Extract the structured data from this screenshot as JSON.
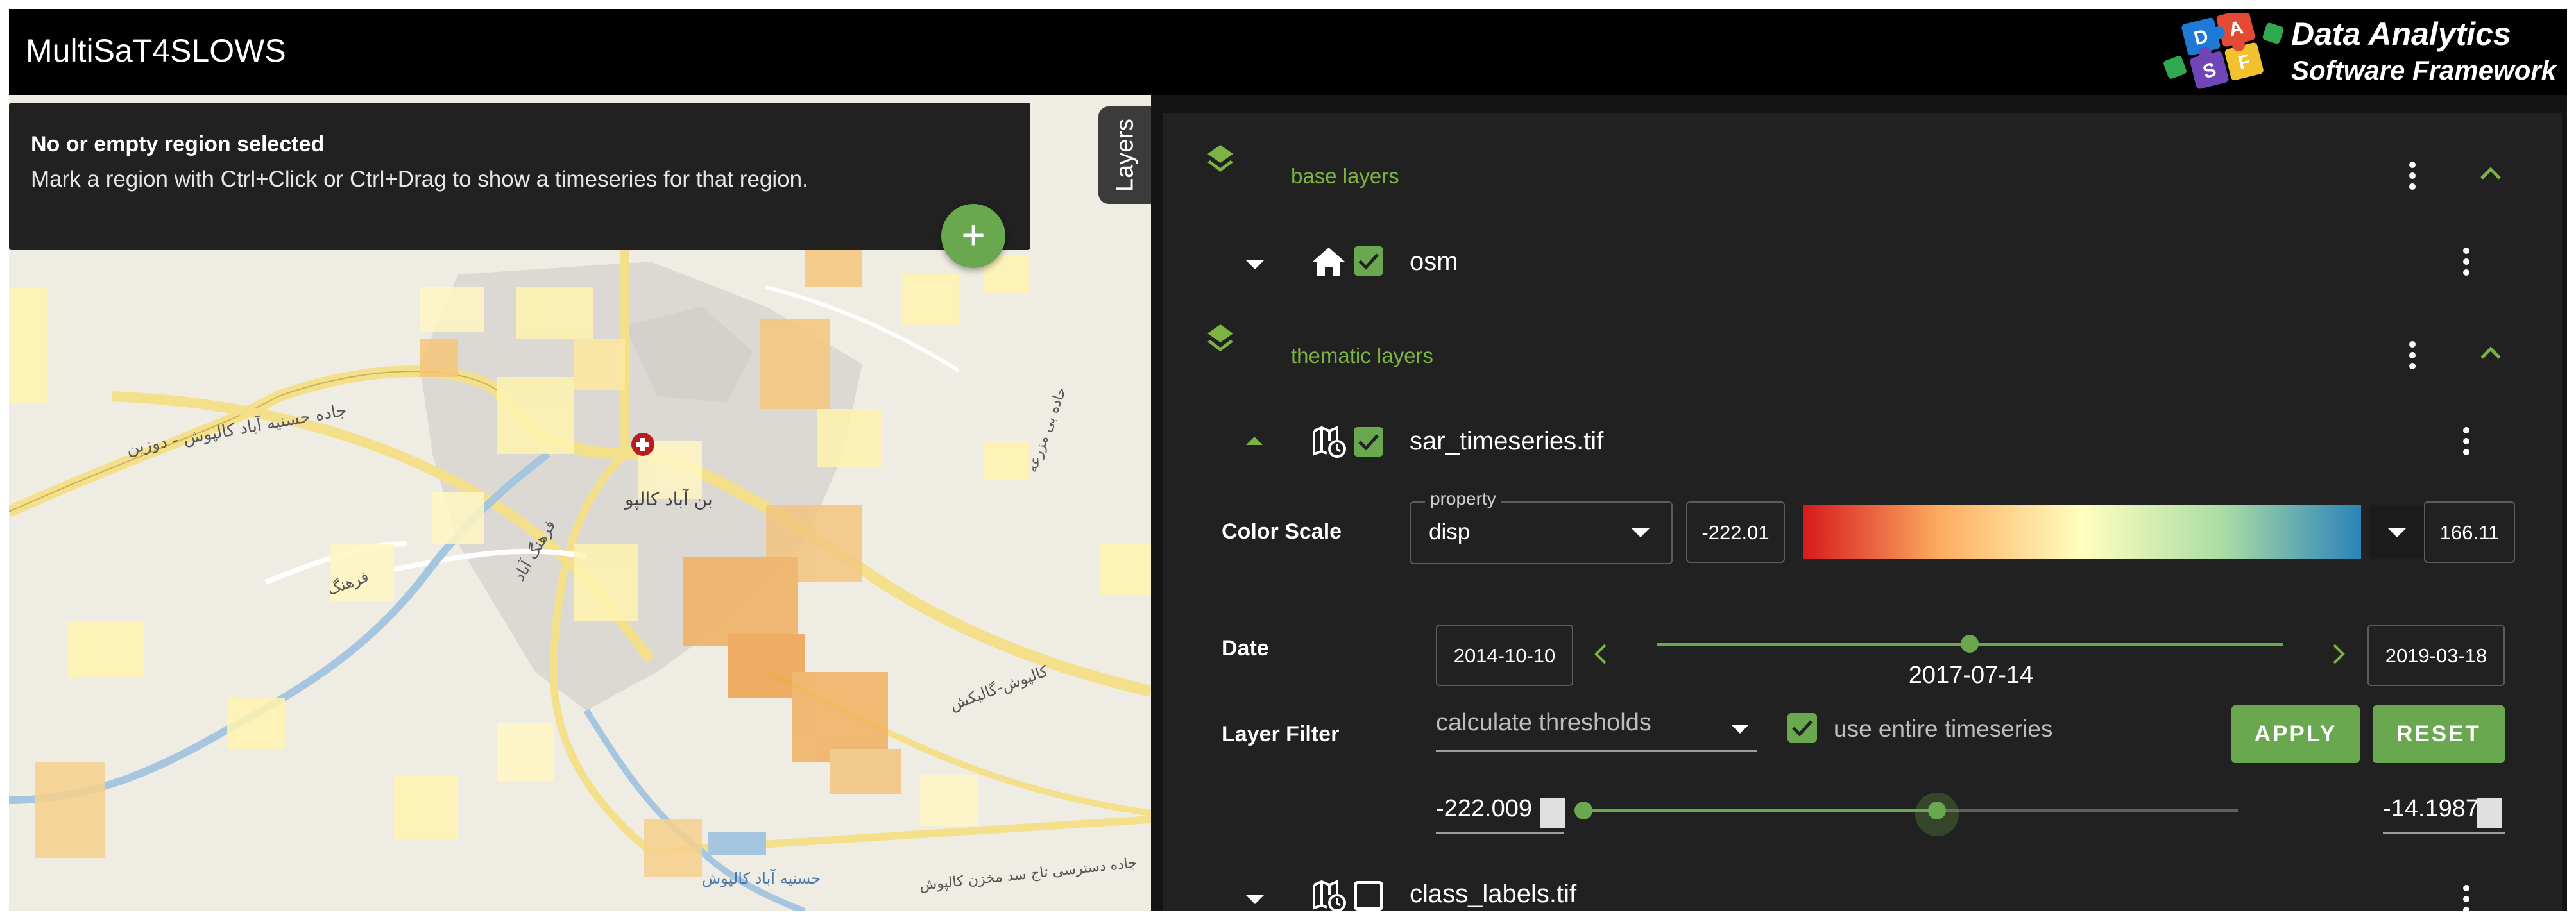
{
  "app": {
    "title": "MultiSaT4SLOWS",
    "brand_line1": "Data Analytics",
    "brand_line2": "Software Framework",
    "brand_letters": [
      "D",
      "A",
      "S",
      "F"
    ]
  },
  "region_card": {
    "title": "No or empty region selected",
    "hint": "Mark a region with Ctrl+Click or Ctrl+Drag to show a timeseries for that region."
  },
  "layers_tab": {
    "label": "Layers"
  },
  "map": {
    "labels": [
      "جاده حسنیه آباد کالپوش - دوزین",
      "بن آباد کالپو",
      "فرهنگ",
      "کالپوش-گالیکش",
      "فرهنگ آباد",
      "جاده دسترسی تاج سد مخزن کالپوش",
      "حسنیه آباد کالپوش",
      "جاده بی مزرعه"
    ]
  },
  "layers": {
    "base_section_label": "base layers",
    "thematic_section_label": "thematic layers",
    "osm": {
      "name": "osm",
      "visible": true
    },
    "sar": {
      "name": "sar_timeseries.tif",
      "visible": true
    },
    "class": {
      "name": "class_labels.tif",
      "visible": false
    }
  },
  "color_scale": {
    "label": "Color Scale",
    "property_legend": "property",
    "property_value": "disp",
    "min": "-222.01",
    "max": "166.11",
    "colormap_stops": [
      "#d7191c",
      "#fdae61",
      "#ffffbf",
      "#abdda4",
      "#2b83ba"
    ]
  },
  "date": {
    "label": "Date",
    "start": "2014-10-10",
    "end": "2019-03-18",
    "current": "2017-07-14",
    "position_fraction": 0.5
  },
  "layer_filter": {
    "label": "Layer Filter",
    "mode": "calculate thresholds",
    "use_entire_label": "use entire timeseries",
    "use_entire_checked": true,
    "apply_label": "APPLY",
    "reset_label": "RESET",
    "min_value": "-222.009",
    "max_value": "-14.1987",
    "range_fraction": [
      0.0,
      0.54
    ]
  },
  "colors": {
    "accent": "#6aa84f",
    "section_green": "#7cb342",
    "panel_bg": "#212121",
    "appbar_bg": "#000000"
  },
  "icons": [
    "layers-stack-icon",
    "kebab-menu-icon",
    "chevron-up-icon",
    "chevron-down-icon",
    "caret-down-icon",
    "home-icon",
    "checkbox-icon",
    "raster-timeseries-icon",
    "chevron-left-icon",
    "chevron-right-icon",
    "plus-icon"
  ]
}
